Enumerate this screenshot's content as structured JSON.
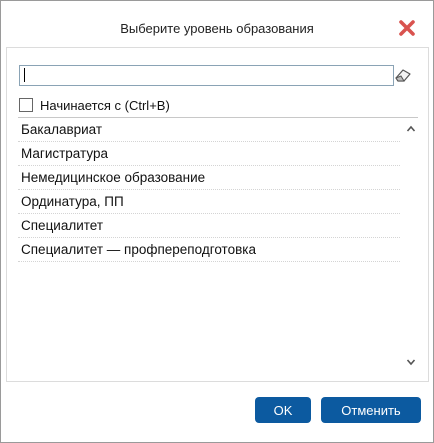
{
  "dialog": {
    "title": "Выберите уровень образования"
  },
  "search": {
    "value": "",
    "placeholder": ""
  },
  "starts_with": {
    "label": "Начинается с (Ctrl+B)",
    "checked": false
  },
  "list": {
    "items": [
      {
        "label": "Бакалавриат"
      },
      {
        "label": "Магистратура"
      },
      {
        "label": "Немедицинское образование"
      },
      {
        "label": "Ординатура, ПП"
      },
      {
        "label": "Специалитет"
      },
      {
        "label": "Специалитет — профпереподготовка"
      }
    ]
  },
  "buttons": {
    "ok_label": "OK",
    "cancel_label": "Отменить"
  },
  "colors": {
    "close_icon": "#d9534f",
    "primary_button": "#0c5aa0"
  },
  "icons": {
    "close": "close-icon",
    "eraser": "eraser-icon",
    "scroll_up": "chevron-up-icon",
    "scroll_down": "chevron-down-icon"
  }
}
